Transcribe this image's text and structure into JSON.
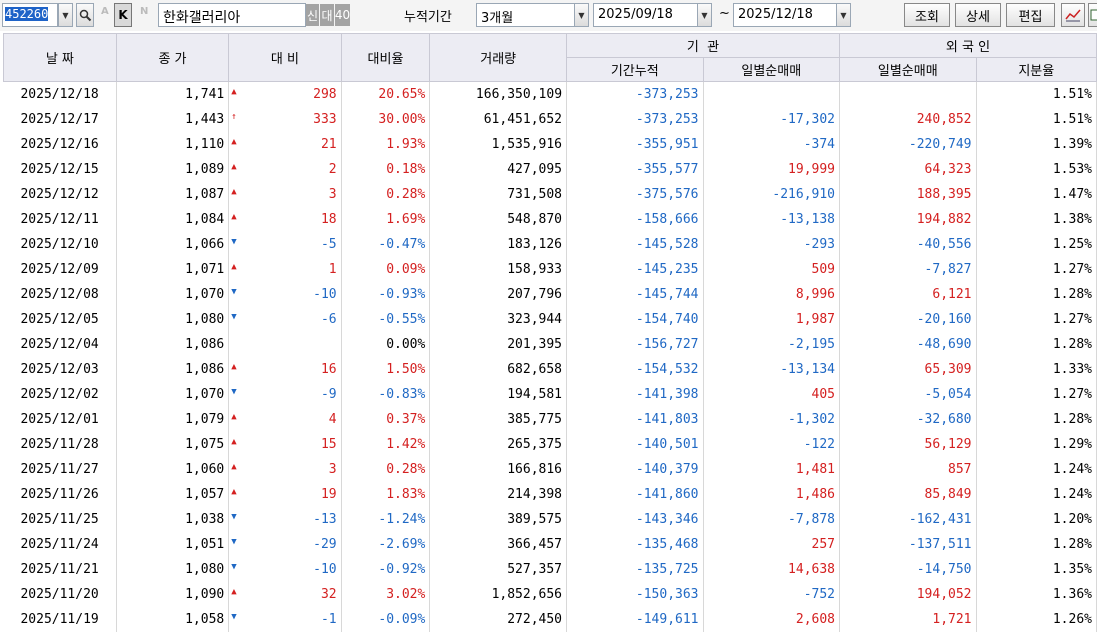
{
  "toolbar": {
    "code": "452260",
    "a_label": "A",
    "k_label": "K",
    "n_label": "N",
    "stock_name": "한화갤러리아",
    "badge_new": "신",
    "badge_loan": "대",
    "badge_num": "40",
    "period_label": "누적기간",
    "period_value": "3개월",
    "start_date": "2025/09/18",
    "tilde": "~",
    "end_date": "2025/12/18",
    "query_label": "조회",
    "detail_label": "상세",
    "edit_label": "편집",
    "dropdown_glyph": "▼",
    "search_glyph": "🔍"
  },
  "colors": {
    "up": "#d42020",
    "down": "#1f68c4",
    "header_bg": "#ececf3"
  },
  "headers": {
    "date": "날 짜",
    "close": "종 가",
    "change": "대 비",
    "rate": "대비율",
    "volume": "거래량",
    "inst": "기  관",
    "inst_cum": "기간누적",
    "inst_daily": "일별순매매",
    "foreign": "외 국 인",
    "foreign_daily": "일별순매매",
    "foreign_share": "지분율"
  },
  "rows": [
    {
      "date": "2025/12/18",
      "close": "1,741",
      "dir": "up",
      "arrow": "▲",
      "change": "298",
      "rate": "20.65%",
      "volume": "166,350,109",
      "inst_cum": "-373,253",
      "inst_daily": "",
      "foreign_daily": "",
      "share": "1.51%"
    },
    {
      "date": "2025/12/17",
      "close": "1,443",
      "dir": "up",
      "arrow": "↑",
      "change": "333",
      "rate": "30.00%",
      "volume": "61,451,652",
      "inst_cum": "-373,253",
      "inst_daily": "-17,302",
      "foreign_daily": "240,852",
      "share": "1.51%"
    },
    {
      "date": "2025/12/16",
      "close": "1,110",
      "dir": "up",
      "arrow": "▲",
      "change": "21",
      "rate": "1.93%",
      "volume": "1,535,916",
      "inst_cum": "-355,951",
      "inst_daily": "-374",
      "foreign_daily": "-220,749",
      "share": "1.39%"
    },
    {
      "date": "2025/12/15",
      "close": "1,089",
      "dir": "up",
      "arrow": "▲",
      "change": "2",
      "rate": "0.18%",
      "volume": "427,095",
      "inst_cum": "-355,577",
      "inst_daily": "19,999",
      "foreign_daily": "64,323",
      "share": "1.53%"
    },
    {
      "date": "2025/12/12",
      "close": "1,087",
      "dir": "up",
      "arrow": "▲",
      "change": "3",
      "rate": "0.28%",
      "volume": "731,508",
      "inst_cum": "-375,576",
      "inst_daily": "-216,910",
      "foreign_daily": "188,395",
      "share": "1.47%"
    },
    {
      "date": "2025/12/11",
      "close": "1,084",
      "dir": "up",
      "arrow": "▲",
      "change": "18",
      "rate": "1.69%",
      "volume": "548,870",
      "inst_cum": "-158,666",
      "inst_daily": "-13,138",
      "foreign_daily": "194,882",
      "share": "1.38%"
    },
    {
      "date": "2025/12/10",
      "close": "1,066",
      "dir": "down",
      "arrow": "▼",
      "change": "-5",
      "rate": "-0.47%",
      "volume": "183,126",
      "inst_cum": "-145,528",
      "inst_daily": "-293",
      "foreign_daily": "-40,556",
      "share": "1.25%"
    },
    {
      "date": "2025/12/09",
      "close": "1,071",
      "dir": "up",
      "arrow": "▲",
      "change": "1",
      "rate": "0.09%",
      "volume": "158,933",
      "inst_cum": "-145,235",
      "inst_daily": "509",
      "foreign_daily": "-7,827",
      "share": "1.27%"
    },
    {
      "date": "2025/12/08",
      "close": "1,070",
      "dir": "down",
      "arrow": "▼",
      "change": "-10",
      "rate": "-0.93%",
      "volume": "207,796",
      "inst_cum": "-145,744",
      "inst_daily": "8,996",
      "foreign_daily": "6,121",
      "share": "1.28%"
    },
    {
      "date": "2025/12/05",
      "close": "1,080",
      "dir": "down",
      "arrow": "▼",
      "change": "-6",
      "rate": "-0.55%",
      "volume": "323,944",
      "inst_cum": "-154,740",
      "inst_daily": "1,987",
      "foreign_daily": "-20,160",
      "share": "1.27%"
    },
    {
      "date": "2025/12/04",
      "close": "1,086",
      "dir": "neutral",
      "arrow": "",
      "change": "",
      "rate": "0.00%",
      "volume": "201,395",
      "inst_cum": "-156,727",
      "inst_daily": "-2,195",
      "foreign_daily": "-48,690",
      "share": "1.28%"
    },
    {
      "date": "2025/12/03",
      "close": "1,086",
      "dir": "up",
      "arrow": "▲",
      "change": "16",
      "rate": "1.50%",
      "volume": "682,658",
      "inst_cum": "-154,532",
      "inst_daily": "-13,134",
      "foreign_daily": "65,309",
      "share": "1.33%"
    },
    {
      "date": "2025/12/02",
      "close": "1,070",
      "dir": "down",
      "arrow": "▼",
      "change": "-9",
      "rate": "-0.83%",
      "volume": "194,581",
      "inst_cum": "-141,398",
      "inst_daily": "405",
      "foreign_daily": "-5,054",
      "share": "1.27%"
    },
    {
      "date": "2025/12/01",
      "close": "1,079",
      "dir": "up",
      "arrow": "▲",
      "change": "4",
      "rate": "0.37%",
      "volume": "385,775",
      "inst_cum": "-141,803",
      "inst_daily": "-1,302",
      "foreign_daily": "-32,680",
      "share": "1.28%"
    },
    {
      "date": "2025/11/28",
      "close": "1,075",
      "dir": "up",
      "arrow": "▲",
      "change": "15",
      "rate": "1.42%",
      "volume": "265,375",
      "inst_cum": "-140,501",
      "inst_daily": "-122",
      "foreign_daily": "56,129",
      "share": "1.29%"
    },
    {
      "date": "2025/11/27",
      "close": "1,060",
      "dir": "up",
      "arrow": "▲",
      "change": "3",
      "rate": "0.28%",
      "volume": "166,816",
      "inst_cum": "-140,379",
      "inst_daily": "1,481",
      "foreign_daily": "857",
      "share": "1.24%"
    },
    {
      "date": "2025/11/26",
      "close": "1,057",
      "dir": "up",
      "arrow": "▲",
      "change": "19",
      "rate": "1.83%",
      "volume": "214,398",
      "inst_cum": "-141,860",
      "inst_daily": "1,486",
      "foreign_daily": "85,849",
      "share": "1.24%"
    },
    {
      "date": "2025/11/25",
      "close": "1,038",
      "dir": "down",
      "arrow": "▼",
      "change": "-13",
      "rate": "-1.24%",
      "volume": "389,575",
      "inst_cum": "-143,346",
      "inst_daily": "-7,878",
      "foreign_daily": "-162,431",
      "share": "1.20%"
    },
    {
      "date": "2025/11/24",
      "close": "1,051",
      "dir": "down",
      "arrow": "▼",
      "change": "-29",
      "rate": "-2.69%",
      "volume": "366,457",
      "inst_cum": "-135,468",
      "inst_daily": "257",
      "foreign_daily": "-137,511",
      "share": "1.28%"
    },
    {
      "date": "2025/11/21",
      "close": "1,080",
      "dir": "down",
      "arrow": "▼",
      "change": "-10",
      "rate": "-0.92%",
      "volume": "527,357",
      "inst_cum": "-135,725",
      "inst_daily": "14,638",
      "foreign_daily": "-14,750",
      "share": "1.35%"
    },
    {
      "date": "2025/11/20",
      "close": "1,090",
      "dir": "up",
      "arrow": "▲",
      "change": "32",
      "rate": "3.02%",
      "volume": "1,852,656",
      "inst_cum": "-150,363",
      "inst_daily": "-752",
      "foreign_daily": "194,052",
      "share": "1.36%"
    },
    {
      "date": "2025/11/19",
      "close": "1,058",
      "dir": "down",
      "arrow": "▼",
      "change": "-1",
      "rate": "-0.09%",
      "volume": "272,450",
      "inst_cum": "-149,611",
      "inst_daily": "2,608",
      "foreign_daily": "1,721",
      "share": "1.26%"
    }
  ]
}
